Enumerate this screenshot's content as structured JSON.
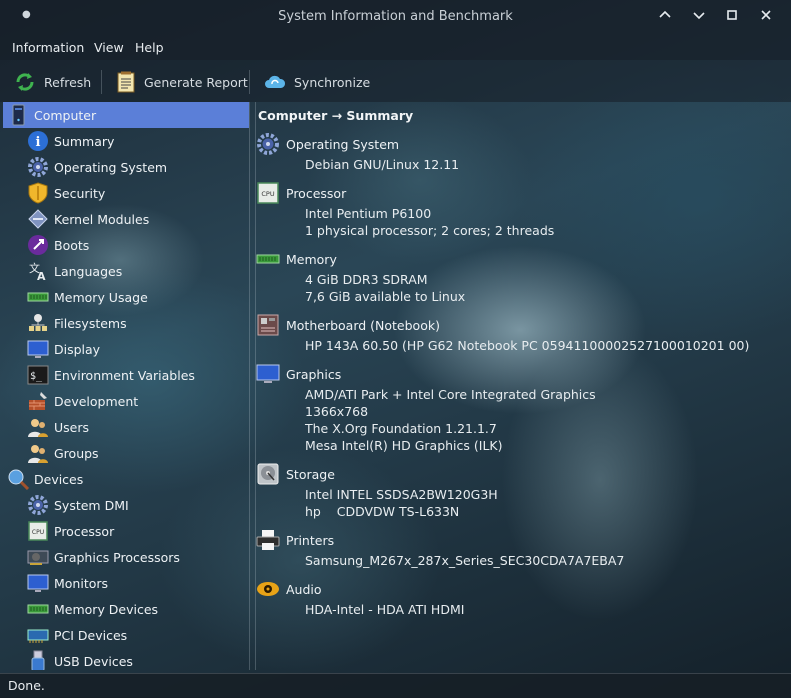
{
  "window": {
    "title": "System Information and Benchmark"
  },
  "menu": [
    "Information",
    "View",
    "Help"
  ],
  "toolbar": {
    "refresh": "Refresh",
    "report": "Generate Report",
    "sync": "Synchronize"
  },
  "sidebar": {
    "computer": "Computer",
    "computer_items": [
      "Summary",
      "Operating System",
      "Security",
      "Kernel Modules",
      "Boots",
      "Languages",
      "Memory Usage",
      "Filesystems",
      "Display",
      "Environment Variables",
      "Development",
      "Users",
      "Groups"
    ],
    "devices": "Devices",
    "device_items": [
      "System DMI",
      "Processor",
      "Graphics Processors",
      "Monitors",
      "Memory Devices",
      "PCI Devices",
      "USB Devices"
    ]
  },
  "content": {
    "heading": "Computer → Summary",
    "sections": [
      {
        "title": "Operating System",
        "values": [
          "Debian GNU/Linux 12.11"
        ]
      },
      {
        "title": "Processor",
        "values": [
          "Intel Pentium P6100",
          "1 physical processor; 2 cores; 2 threads"
        ]
      },
      {
        "title": "Memory",
        "values": [
          "4 GiB DDR3 SDRAM",
          "7,6 GiB available to Linux"
        ]
      },
      {
        "title": "Motherboard (Notebook)",
        "values": [
          "HP 143A 60.50 (HP G62 Notebook PC 05941100002527100010201 00)"
        ]
      },
      {
        "title": "Graphics",
        "values": [
          "AMD/ATI Park + Intel Core Integrated Graphics",
          "1366x768",
          "The X.Org Foundation 1.21.1.7",
          "Mesa Intel(R) HD Graphics (ILK)"
        ]
      },
      {
        "title": "Storage",
        "values": [
          "Intel INTEL SSDSA2BW120G3H",
          "hp    CDDVDW TS-L633N"
        ]
      },
      {
        "title": "Printers",
        "values": [
          "Samsung_M267x_287x_Series_SEC30CDA7A7EBA7"
        ]
      },
      {
        "title": "Audio",
        "values": [
          "HDA-Intel - HDA ATI HDMI"
        ]
      }
    ]
  },
  "status": "Done."
}
